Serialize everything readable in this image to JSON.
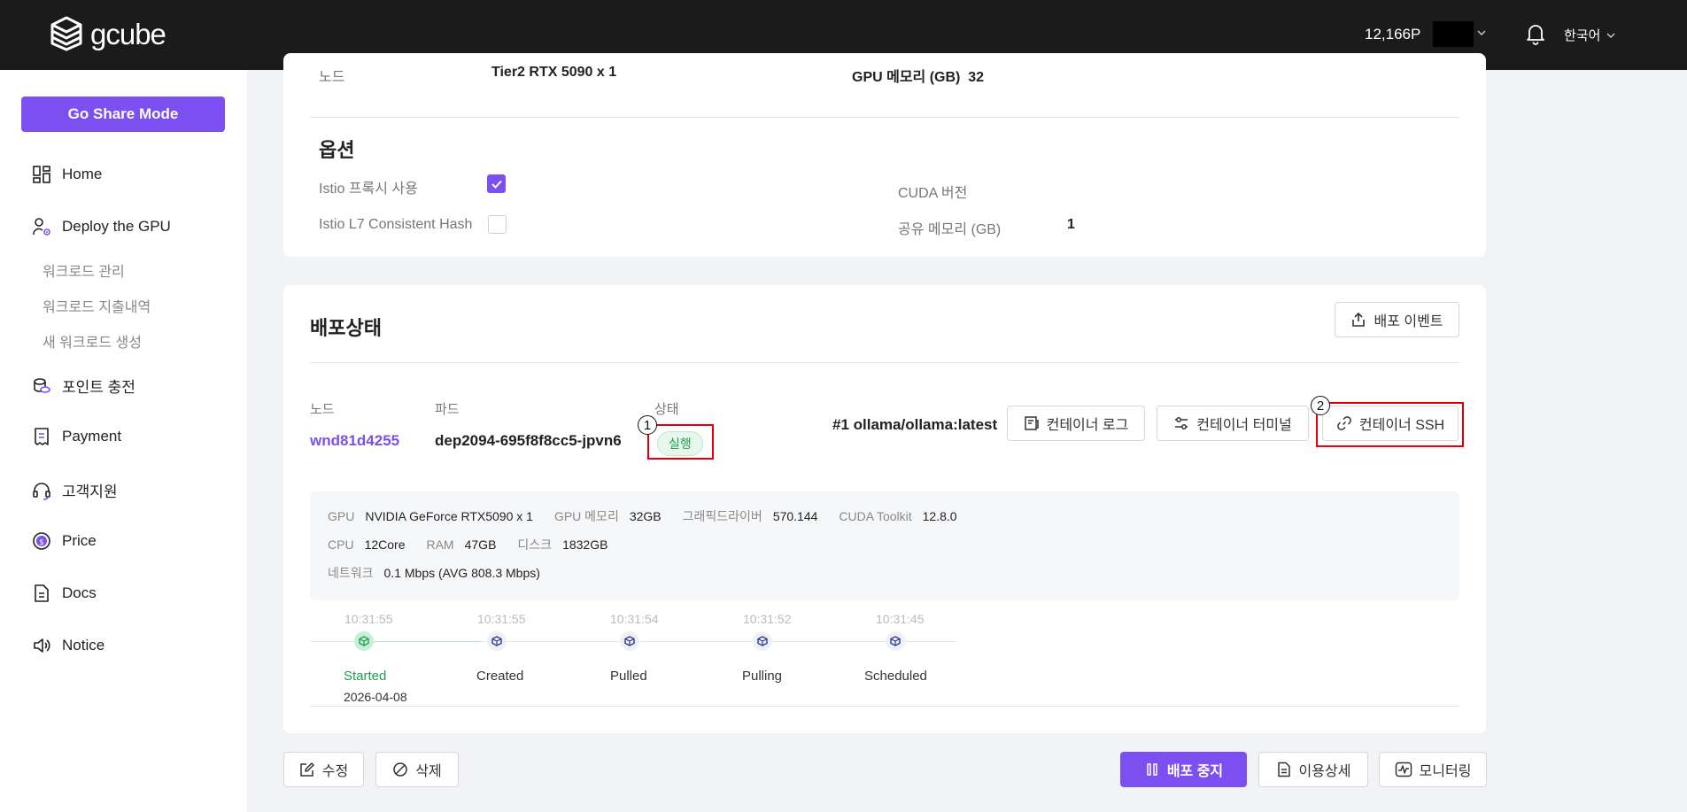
{
  "topbar": {
    "logo_text": "gcube",
    "points": "12,166P",
    "language": "한국어"
  },
  "sidebar": {
    "share_button": "Go Share Mode",
    "items": [
      {
        "label": "Home",
        "icon": "dashboard-icon"
      },
      {
        "label": "Deploy the GPU",
        "icon": "user-gear-icon"
      },
      {
        "label": "포인트 충전",
        "icon": "coins-icon"
      },
      {
        "label": "Payment",
        "icon": "receipt-icon"
      },
      {
        "label": "고객지원",
        "icon": "headset-icon"
      },
      {
        "label": "Price",
        "icon": "dollar-circle-icon"
      },
      {
        "label": "Docs",
        "icon": "document-icon"
      },
      {
        "label": "Notice",
        "icon": "speaker-icon"
      }
    ],
    "sub_items": [
      "워크로드 관리",
      "워크로드 지출내역",
      "새 워크로드 생성"
    ]
  },
  "spec": {
    "node_label": "노드",
    "node_value": "Tier2 RTX 5090 x 1",
    "gpu_mem_label": "GPU 메모리 (GB)",
    "gpu_mem_value": "32"
  },
  "options": {
    "title": "옵션",
    "istio_proxy_label": "Istio 프록시 사용",
    "istio_proxy_checked": true,
    "istio_l7_label": "Istio L7 Consistent Hash",
    "istio_l7_checked": false,
    "cuda_label": "CUDA 버전",
    "cuda_value": "",
    "shm_label": "공유 메모리 (GB)",
    "shm_value": "1"
  },
  "deploy_status": {
    "title": "배포상태",
    "events_button": "배포 이벤트",
    "node_header": "노드",
    "pod_header": "파드",
    "state_header": "상태",
    "node_value": "wnd81d4255",
    "pod_value": "dep2094-695f8f8cc5-jpvn6",
    "state_value": "실행",
    "image": "#1 ollama/ollama:latest",
    "log_button": "컨테이너 로그",
    "terminal_button": "컨테이너 터미널",
    "ssh_button": "컨테이너 SSH",
    "annotation_1": "1",
    "annotation_2": "2",
    "resources": {
      "gpu_k": "GPU",
      "gpu_v": "NVIDIA GeForce RTX5090 x 1",
      "gpumem_k": "GPU 메모리",
      "gpumem_v": "32GB",
      "driver_k": "그래픽드라이버",
      "driver_v": "570.144",
      "cuda_k": "CUDA Toolkit",
      "cuda_v": "12.8.0",
      "cpu_k": "CPU",
      "cpu_v": "12Core",
      "ram_k": "RAM",
      "ram_v": "47GB",
      "disk_k": "디스크",
      "disk_v": "1832GB",
      "net_k": "네트워크",
      "net_v": "0.1 Mbps (AVG 808.3 Mbps)"
    },
    "timeline": [
      {
        "time": "10:31:55",
        "label": "Started",
        "date": "2026-04-08",
        "active": true
      },
      {
        "time": "10:31:55",
        "label": "Created",
        "active": false
      },
      {
        "time": "10:31:54",
        "label": "Pulled",
        "active": false
      },
      {
        "time": "10:31:52",
        "label": "Pulling",
        "active": false
      },
      {
        "time": "10:31:45",
        "label": "Scheduled",
        "active": false
      }
    ]
  },
  "actions": {
    "edit": "수정",
    "delete": "삭제",
    "stop": "배포 중지",
    "usage": "이용상세",
    "monitoring": "모니터링"
  },
  "colors": {
    "accent": "#7b4ff0",
    "topbar": "#1b1b1b",
    "success": "#1f9d4f",
    "annotation": "#e0000b"
  }
}
